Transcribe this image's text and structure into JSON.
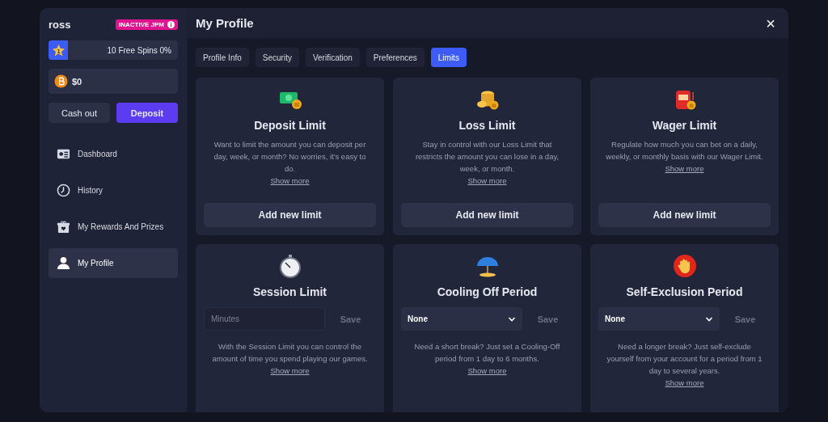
{
  "sidebar": {
    "username": "ross",
    "badge": "INACTIVE JPM",
    "spins": {
      "rank": "1",
      "label": "10 Free Spins 0%"
    },
    "balance": "$0",
    "buttons": [
      {
        "label": "Cash out",
        "kind": "secondary"
      },
      {
        "label": "Deposit",
        "kind": "primary"
      }
    ],
    "items": [
      {
        "label": "Dashboard",
        "selected": false
      },
      {
        "label": "History",
        "selected": false
      },
      {
        "label": "My Rewards And Prizes",
        "selected": false
      },
      {
        "label": "My Profile",
        "selected": true
      }
    ]
  },
  "header": {
    "title": "My Profile",
    "close": "×"
  },
  "tabs": [
    {
      "label": "Profile Info",
      "selected": false
    },
    {
      "label": "Security",
      "selected": false
    },
    {
      "label": "Verification",
      "selected": false
    },
    {
      "label": "Preferences",
      "selected": false
    },
    {
      "label": "Limits",
      "selected": true
    }
  ],
  "cards": [
    {
      "title": "Deposit Limit",
      "kind": "button",
      "action": "Add new limit",
      "text": "Want to limit the amount you can deposit per day, week, or month? No worries, it's easy to do.",
      "link": "Show more"
    },
    {
      "title": "Loss Limit",
      "kind": "button",
      "action": "Add new limit",
      "text": "Stay in control with our Loss Limit that restricts the amount you can lose in a day, week, or month.",
      "link": "Show more"
    },
    {
      "title": "Wager Limit",
      "kind": "button",
      "action": "Add new limit",
      "text": "Regulate how much you can bet on a daily, weekly, or monthly basis with our Wager Limit.",
      "link": "Show more"
    },
    {
      "title": "Session Limit",
      "kind": "input",
      "placeholder": "Minutes",
      "save": "Save",
      "text": "With the Session Limit you can control the amount of time you spend playing our games.",
      "link": "Show more"
    },
    {
      "title": "Cooling Off Period",
      "kind": "select",
      "value": "None",
      "save": "Save",
      "text": "Need a short break? Just set a Cooling-Off period from 1 day to 6 months.",
      "link": "Show more"
    },
    {
      "title": "Self-Exclusion Period",
      "kind": "select",
      "value": "None",
      "save": "Save",
      "text": "Need a longer break? Just self-exclude yourself from your account for a period from 1 day to several years.",
      "link": "Show more"
    }
  ]
}
